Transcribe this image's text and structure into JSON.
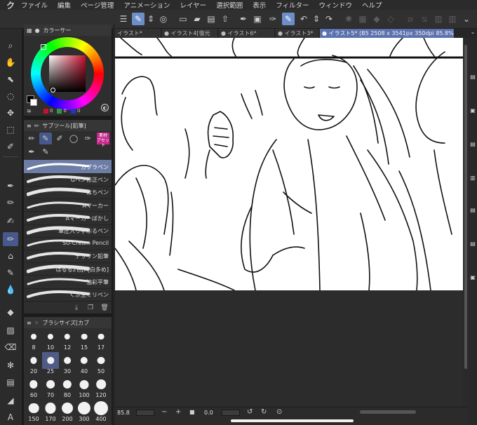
{
  "menu": {
    "logo": "ク",
    "items": [
      "ファイル",
      "編集",
      "ページ管理",
      "アニメーション",
      "レイヤー",
      "選択範囲",
      "表示",
      "フィルター",
      "ウィンドウ",
      "ヘルプ"
    ]
  },
  "color_panel": {
    "tab_title": "カラーサー",
    "main_color": "#000000",
    "sub_color": "#ffffff",
    "swatches": [
      {
        "color": "#c8102e",
        "value": "0"
      },
      {
        "color": "#2e9a3b",
        "value": "0"
      },
      {
        "color": "#2036c8",
        "value": "0"
      }
    ]
  },
  "sub_tool": {
    "tab_title": "サブツール[鉛筆]",
    "badge": "素材\nアセット",
    "brushes": [
      {
        "label": "カブラペン",
        "selected": true
      },
      {
        "label": "Gペン修正ペン",
        "selected": false
      },
      {
        "label": "はちペン",
        "selected": false
      },
      {
        "label": "Aマーカー",
        "selected": false
      },
      {
        "label": "Aマーカーぼかし",
        "selected": false
      },
      {
        "label": "筆圧入り手ぶるペン",
        "selected": false
      },
      {
        "label": "SU-Cream Pencil",
        "selected": false
      },
      {
        "label": "デッサン鉛筆",
        "selected": false
      },
      {
        "label": "はるる2色[A|白多め]",
        "selected": false
      },
      {
        "label": "油彩平筆",
        "selected": false
      },
      {
        "label": "くぷ生ミリペン",
        "selected": false
      }
    ]
  },
  "brush_size": {
    "tab_title": "ブラシサイズ[カブ",
    "sizes": [
      "8",
      "10",
      "12",
      "15",
      "17",
      "20",
      "25",
      "30",
      "40",
      "50",
      "60",
      "70",
      "80",
      "100",
      "120",
      "150",
      "170",
      "200",
      "300",
      "400"
    ],
    "selected": "25"
  },
  "doc_tabs": [
    {
      "label": "イラスト*",
      "active": false
    },
    {
      "label": "● イラスト4[復元",
      "active": false
    },
    {
      "label": "● イラスト6*",
      "active": false
    },
    {
      "label": "● イラスト3*",
      "active": false
    },
    {
      "label": "● イラスト5* (B5 2508 x 3541px 350dpi 85.8%)",
      "active": true
    }
  ],
  "statusbar": {
    "zoom": "85.8",
    "minus": "−",
    "plus": "+",
    "angle": "0.0"
  }
}
